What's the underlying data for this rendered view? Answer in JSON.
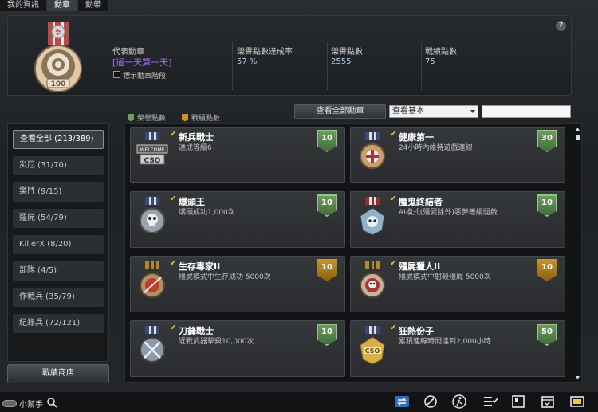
{
  "tabs": [
    "我的資訊",
    "勳章",
    "勳帶"
  ],
  "header": {
    "rep_label": "代表勳章",
    "rep_name": "[過一天算一天]",
    "checkbox_label": "標示勳章階段",
    "stats": [
      {
        "label": "榮譽點數達成率",
        "value": "57 %"
      },
      {
        "label": "榮譽點數",
        "value": "2555"
      },
      {
        "label": "戰績點數",
        "value": "75"
      }
    ],
    "help": "?"
  },
  "filter": {
    "legend_honor": "榮譽點數",
    "legend_record": "戰績點數",
    "view_all": "查看全部勳章",
    "select_value": "查看基本"
  },
  "sidebar": {
    "items": [
      {
        "label": "查看全部 (213/389)",
        "active": true
      },
      {
        "label": "災厄 (31/70)"
      },
      {
        "label": "樂鬥 (9/15)"
      },
      {
        "label": "殭屍 (54/79)"
      },
      {
        "label": "KillerX (8/20)"
      },
      {
        "label": "部隊 (4/5)"
      },
      {
        "label": "作戰兵 (35/79)"
      },
      {
        "label": "紀錄兵 (72/121)"
      }
    ],
    "shop": "戰績商店"
  },
  "medals": [
    {
      "title": "新兵戰士",
      "desc": "達成等級6",
      "points": "10",
      "kind": "green",
      "icon": "welcome-badge-icon"
    },
    {
      "title": "健康第一",
      "desc": "24小時內維持遊戲連線",
      "points": "30",
      "kind": "green",
      "icon": "health-medal-icon"
    },
    {
      "title": "爆頭王",
      "desc": "爆頭成功1,000次",
      "points": "10",
      "kind": "green",
      "icon": "skull-medal-icon"
    },
    {
      "title": "魔鬼終結者",
      "desc": "AI模式(殭屍除外)惡夢等級開啟",
      "points": "10",
      "kind": "green",
      "icon": "demon-medal-icon"
    },
    {
      "title": "生存專家II",
      "desc": "殭屍模式中生存成功 5000次",
      "points": "10",
      "kind": "gold",
      "icon": "survival-medal-icon"
    },
    {
      "title": "殭屍獵人II",
      "desc": "殭屍模式中射殺殭屍 5000次",
      "points": "10",
      "kind": "gold",
      "icon": "zombie-hunter-medal-icon"
    },
    {
      "title": "刀鋒戰士",
      "desc": "近戰武器擊殺10,000次",
      "points": "10",
      "kind": "green",
      "icon": "blade-medal-icon"
    },
    {
      "title": "狂熱份子",
      "desc": "累積連線時間達到2,000小時",
      "points": "50",
      "kind": "green",
      "icon": "fanatic-medal-icon"
    }
  ],
  "bottom": {
    "helper_label": "小幫手"
  },
  "colors": {
    "rep_name": "#a86df0",
    "stat_value": "#b7c9e8",
    "check": "#f0c020"
  }
}
